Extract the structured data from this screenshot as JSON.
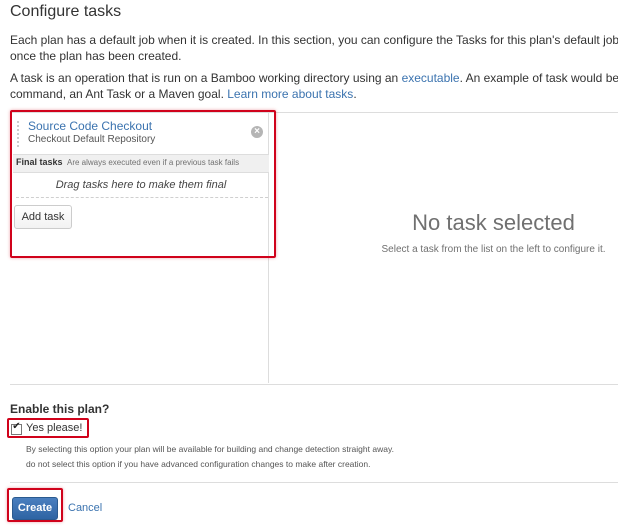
{
  "page": {
    "title": "Configure tasks",
    "description_1": "Each plan has a default job when it is created. In this section, you can configure the Tasks for this plan's default job. You can add m",
    "description_2": "once the plan has been created.",
    "description_3_prefix": "A task is an operation that is run on a Bamboo working directory using an ",
    "description_3_link": "executable",
    "description_3_suffix": ". An example of task would be the execution o",
    "description_4_prefix": "command, an Ant Task or a Maven goal. ",
    "description_4_link": "Learn more about tasks",
    "description_4_suffix": "."
  },
  "tasks": {
    "items": [
      {
        "name": "Source Code Checkout",
        "description": "Checkout Default Repository"
      }
    ],
    "final_label": "Final tasks",
    "final_note": "Are always executed even if a previous task fails",
    "drop_hint": "Drag tasks here to make them final",
    "add_task_label": "Add task"
  },
  "detail": {
    "empty_title": "No task selected",
    "empty_help": "Select a task from the list on the left to configure it."
  },
  "enable": {
    "title": "Enable this plan?",
    "checkbox_label": "Yes please!",
    "checked": true,
    "help_1": "By selecting this option your plan will be available for building and change detection straight away.",
    "help_2": "do not select this option if you have advanced configuration changes to make after creation."
  },
  "actions": {
    "create_label": "Create",
    "cancel_label": "Cancel"
  },
  "colors": {
    "link": "#3b73af",
    "highlight": "#d0021b",
    "primary_button": "#3572b0"
  }
}
